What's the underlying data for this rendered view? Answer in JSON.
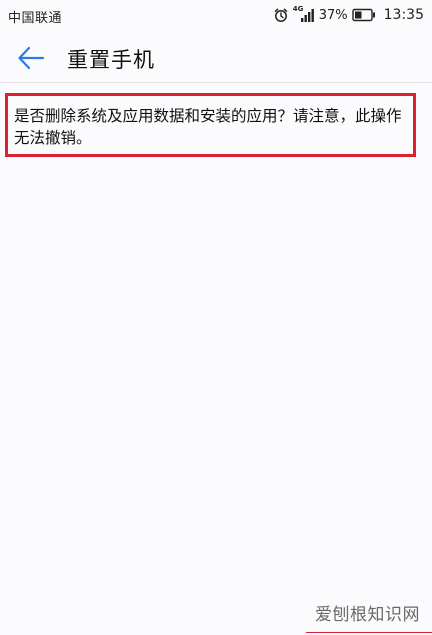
{
  "status_bar": {
    "carrier": "中国联通",
    "network_type": "4G",
    "battery_percent": "37%",
    "time": "13:35"
  },
  "app_bar": {
    "title": "重置手机",
    "back_icon": "back-arrow-icon"
  },
  "message": {
    "text": "是否删除系统及应用数据和安装的应用？请注意，此操作无法撤销。"
  },
  "watermark": {
    "text": "爱刨根知识网"
  },
  "colors": {
    "accent": "#2a7be8",
    "highlight_border": "#d9232e",
    "background": "#fbfbfd"
  }
}
